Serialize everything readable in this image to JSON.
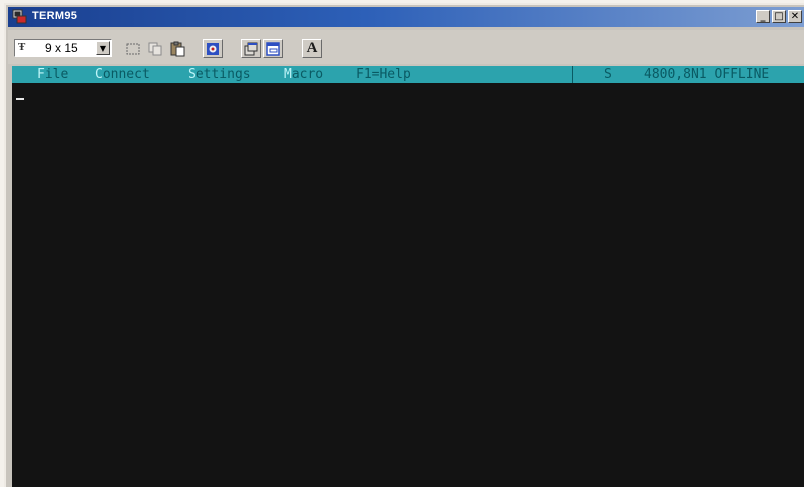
{
  "window": {
    "title": "TERM95",
    "icon": "term95-app-icon",
    "controls": {
      "minimize": "_",
      "maximize": "□",
      "close": "✕"
    }
  },
  "toolbar": {
    "font_icon": "Ŧ",
    "font_size": "9 x 15",
    "buttons": [
      "mark-icon",
      "copy-icon",
      "paste-icon",
      "connect-icon",
      "properties-icon",
      "window-icon",
      "font-icon"
    ],
    "font_button_label": "A"
  },
  "menubar": {
    "items": [
      {
        "hotkey": "F",
        "rest": "ile"
      },
      {
        "hotkey": "C",
        "rest": "onnect"
      },
      {
        "hotkey": "S",
        "rest": "ettings"
      },
      {
        "hotkey": "M",
        "rest": "acro"
      }
    ],
    "help": "F1=Help",
    "status_indicator": "S",
    "status": "4800,8N1 OFFLINE"
  },
  "colors": {
    "title_gradient_start": "#1a3f8f",
    "menubar_bg": "#2ca3ad",
    "terminal_bg": "#131313"
  }
}
